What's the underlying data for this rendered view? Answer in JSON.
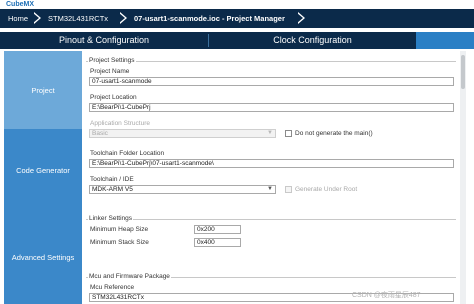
{
  "app": {
    "brand": "CubeMX"
  },
  "breadcrumb": {
    "items": [
      {
        "label": "Home"
      },
      {
        "label": "STM32L431RCTx"
      },
      {
        "label": "07-usart1-scanmode.ioc - Project Manager"
      }
    ]
  },
  "tabs": [
    {
      "label": "Pinout & Configuration"
    },
    {
      "label": "Clock Configuration"
    }
  ],
  "sidebar": {
    "items": [
      {
        "label": "Project",
        "selected": true
      },
      {
        "label": "Code Generator",
        "selected": false
      },
      {
        "label": "Advanced Settings",
        "selected": false
      }
    ]
  },
  "project_settings": {
    "title": "Project Settings",
    "name_label": "Project Name",
    "name_value": "07-usart1-scanmode",
    "location_label": "Project Location",
    "location_value": "E:\\BearPi\\1-CubePrj",
    "structure_label": "Application Structure",
    "structure_value": "Basic",
    "no_main_label": "Do not generate the main()",
    "toolchain_folder_label": "Toolchain Folder Location",
    "toolchain_folder_value": "E:\\BearPi\\1-CubePrj\\07-usart1-scanmode\\",
    "toolchain_label": "Toolchain / IDE",
    "toolchain_value": "MDK-ARM V5",
    "under_root_label": "Generate Under Root"
  },
  "linker_settings": {
    "title": "Linker Settings",
    "heap_label": "Minimum Heap Size",
    "heap_value": "0x200",
    "stack_label": "Minimum Stack Size",
    "stack_value": "0x400"
  },
  "mcu_package": {
    "title": "Mcu and Firmware Package",
    "reference_label": "Mcu Reference",
    "reference_value": "STM32L431RCTx"
  },
  "watermark": "CSDN @夜雨星辰487",
  "colors": {
    "nav_dark": "#0b2a4a",
    "sidebar_selected": "#6da9d9",
    "sidebar_default": "#3b88c9",
    "brand": "#1f6fb5"
  }
}
